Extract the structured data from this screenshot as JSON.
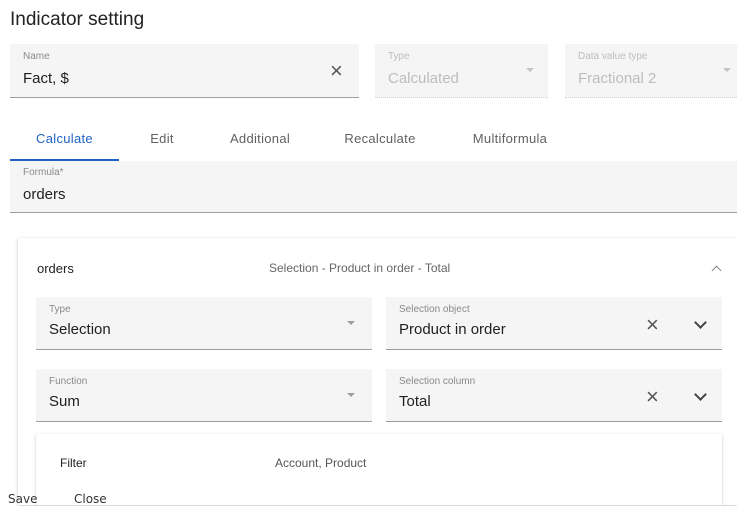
{
  "page_title": "Indicator setting",
  "name_field": {
    "label": "Name",
    "value": "Fact, $"
  },
  "type_field": {
    "label": "Type",
    "value": "Calculated"
  },
  "data_value_type_field": {
    "label": "Data value type",
    "value": "Fractional 2"
  },
  "tabs": [
    {
      "label": "Calculate",
      "active": true
    },
    {
      "label": "Edit"
    },
    {
      "label": "Additional"
    },
    {
      "label": "Recalculate"
    },
    {
      "label": "Multiformula"
    }
  ],
  "formula_field": {
    "label": "Formula*",
    "value": "orders"
  },
  "variable_panel": {
    "name": "orders",
    "description": "Selection - Product in order - Total",
    "type": {
      "label": "Type",
      "value": "Selection"
    },
    "selection_object": {
      "label": "Selection object",
      "value": "Product in order"
    },
    "function": {
      "label": "Function",
      "value": "Sum"
    },
    "selection_column": {
      "label": "Selection column",
      "value": "Total"
    },
    "filter": {
      "label": "Filter",
      "value": "Account, Product"
    }
  },
  "actions": {
    "save": "Save",
    "close": "Close"
  },
  "colors": {
    "accent": "#1e63c4",
    "field_bg": "#f5f5f5"
  },
  "icons": [
    "clear-icon",
    "dropdown-arrow-icon",
    "chevron-down-icon",
    "chevron-up-icon"
  ]
}
